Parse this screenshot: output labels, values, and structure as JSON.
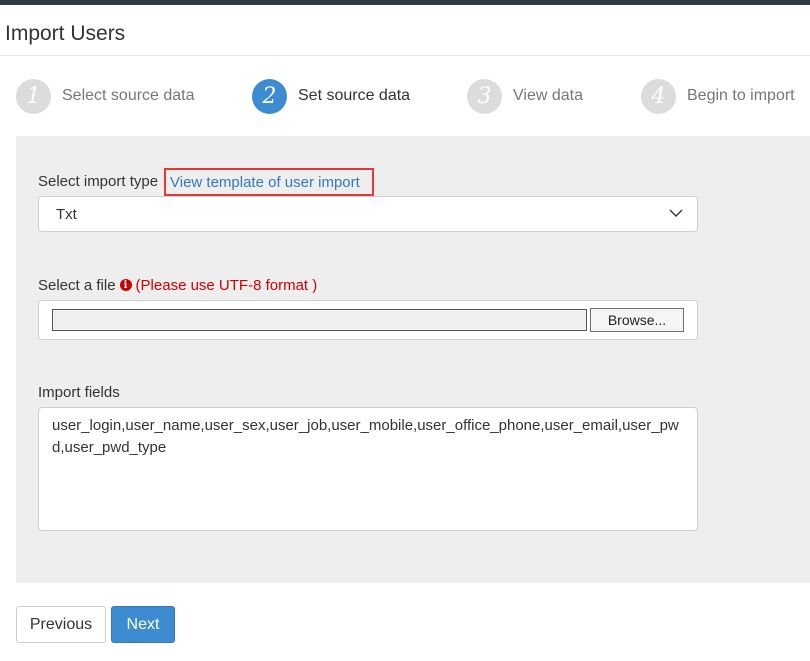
{
  "page": {
    "title": "Import Users"
  },
  "steps": [
    {
      "number": "1",
      "label": "Select source data",
      "active": false
    },
    {
      "number": "2",
      "label": "Set source data",
      "active": true
    },
    {
      "number": "3",
      "label": "View data",
      "active": false
    },
    {
      "number": "4",
      "label": "Begin to import",
      "active": false
    }
  ],
  "import_type": {
    "label": "Select import type",
    "template_link": "View template of user import",
    "selected": "Txt"
  },
  "file": {
    "label": "Select a file",
    "note": "(Please use UTF-8 format )",
    "path_value": "",
    "browse_label": "Browse..."
  },
  "fields": {
    "label": "Import fields",
    "value": "user_login,user_name,user_sex,user_job,user_mobile,user_office_phone,user_email,user_pwd,user_pwd_type"
  },
  "buttons": {
    "previous": "Previous",
    "next": "Next"
  },
  "colors": {
    "accent": "#3d8cd1",
    "step_inactive": "#dcdcdc",
    "warning": "#d40000",
    "link": "#337ab7",
    "highlight_border": "#e53935",
    "topbar": "#2f3a46",
    "panel_bg": "#eeeeee"
  },
  "icons": {
    "select_arrow": "chevron-down-icon",
    "file_note": "info-icon"
  }
}
